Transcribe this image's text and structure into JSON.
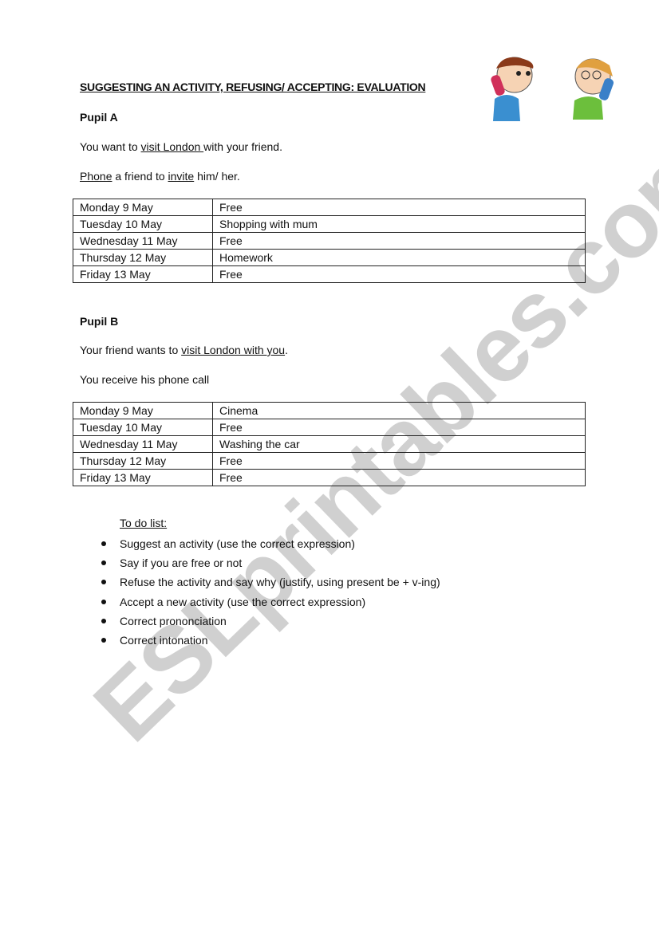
{
  "title": "SUGGESTING AN ACTIVITY, REFUSING/ ACCEPTING: EVALUATION",
  "pupil_a": {
    "heading": "Pupil A",
    "line1": {
      "pre": "You want to ",
      "u": "visit London ",
      "post": "with your friend."
    },
    "line2": {
      "u1": "Phone",
      "mid": " a friend to ",
      "u2": "invite",
      "post": " him/ her."
    },
    "schedule": [
      [
        "Monday 9 May",
        "Free"
      ],
      [
        "Tuesday 10 May",
        "Shopping with mum"
      ],
      [
        "Wednesday 11 May",
        "Free"
      ],
      [
        "Thursday 12 May",
        "Homework"
      ],
      [
        "Friday 13 May",
        "Free"
      ]
    ]
  },
  "pupil_b": {
    "heading": "Pupil B",
    "line1": {
      "pre": "Your friend wants to ",
      "u": "visit London with you",
      "post": "."
    },
    "line2": "You receive his phone call",
    "schedule": [
      [
        "Monday 9 May",
        "Cinema"
      ],
      [
        "Tuesday 10 May",
        "Free"
      ],
      [
        "Wednesday 11 May",
        "Washing the car"
      ],
      [
        "Thursday 12 May",
        "Free"
      ],
      [
        "Friday 13 May",
        "Free"
      ]
    ]
  },
  "todo": {
    "heading": "To do list:",
    "items": [
      "Suggest an activity (use the correct expression)",
      "Say if you are free or not",
      "Refuse the activity and say why (justify, using present be + v-ing)",
      "Accept a new activity (use the correct expression)",
      "Correct prononciation",
      "Correct intonation"
    ]
  },
  "watermark": "ESLprintables.com"
}
